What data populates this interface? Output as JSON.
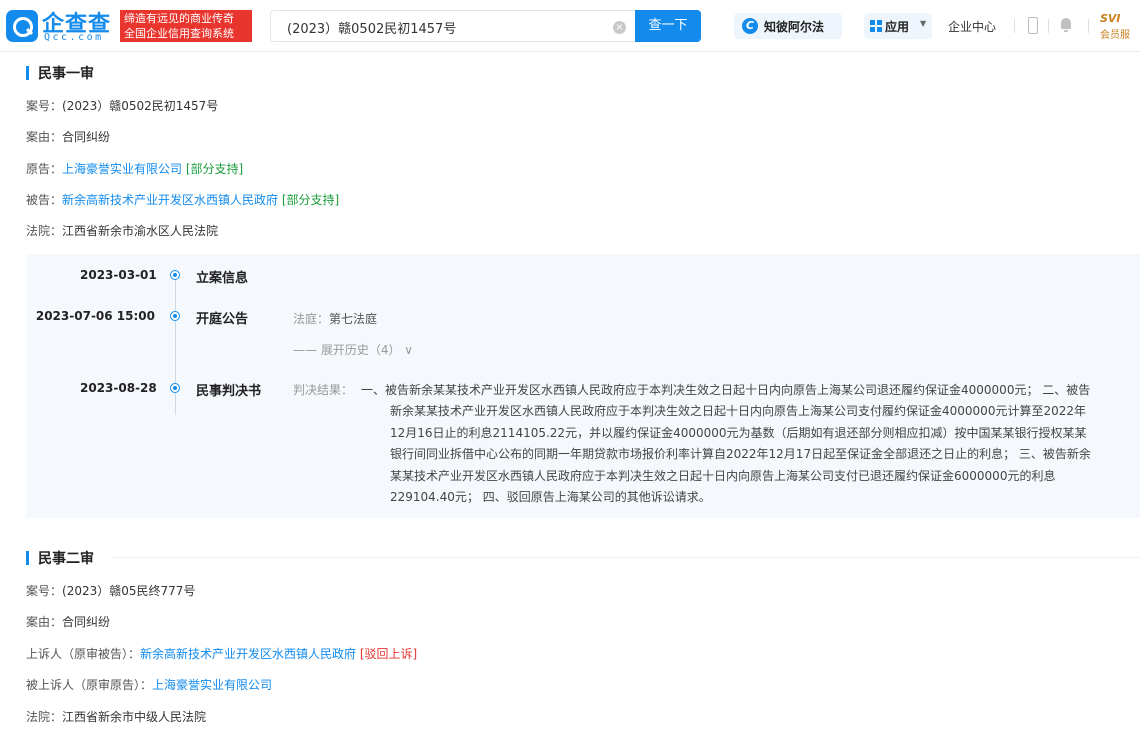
{
  "header": {
    "logo_text": "企查查",
    "logo_sub": "Qcc.com",
    "slogan_line1": "缔造有远见的商业传奇",
    "slogan_line2": "全国企业信用查询系统",
    "search_value": "(2023）赣0502民初1457号",
    "search_button": "查一下",
    "zhibi_label": "知彼阿尔法",
    "zhibi_icon_glyph": "C",
    "apps_label": "应用",
    "enterprise_label": "企业中心",
    "vip_top": "SVI",
    "vip_bottom": "会员服"
  },
  "first_instance": {
    "title": "民事一审",
    "case_no_k": "案号：",
    "case_no_v": "(2023）赣0502民初1457号",
    "cause_k": "案由：",
    "cause_v": "合同纠纷",
    "plaintiff_k": "原告：",
    "plaintiff_v": "上海豪誉实业有限公司",
    "plaintiff_tag": "[部分支持]",
    "defendant_k": "被告：",
    "defendant_v": "新余高新技术产业开发区水西镇人民政府",
    "defendant_tag": "[部分支持]",
    "court_k": "法院：",
    "court_v": "江西省新余市渝水区人民法院"
  },
  "timeline": [
    {
      "date": "2023-03-01",
      "label": "立案信息"
    },
    {
      "date": "2023-07-06 15:00",
      "label": "开庭公告",
      "detail_k": "法庭：",
      "detail_v": "第七法庭",
      "expand": "—— 展开历史（4） ∨"
    },
    {
      "date": "2023-08-28",
      "label": "民事判决书",
      "detail_k": "判决结果：",
      "detail_v": "一、被告新余某某技术产业开发区水西镇人民政府应于本判决生效之日起十日内向原告上海某公司退还履约保证金4000000元；  二、被告新余某某技术产业开发区水西镇人民政府应于本判决生效之日起十日内向原告上海某公司支付履约保证金4000000元计算至2022年12月16日止的利息2114105.22元，并以履约保证金4000000元为基数（后期如有退还部分则相应扣减）按中国某某银行授权某某银行间同业拆借中心公布的同期一年期贷款市场报价利率计算自2022年12月17日起至保证金全部退还之日止的利息；  三、被告新余某某技术产业开发区水西镇人民政府应于本判决生效之日起十日内向原告上海某公司支付已退还履约保证金6000000元的利息229104.40元；  四、驳回原告上海某公司的其他诉讼请求。"
    }
  ],
  "second_instance": {
    "title": "民事二审",
    "case_no_k": "案号：",
    "case_no_v": "(2023）赣05民终777号",
    "cause_k": "案由：",
    "cause_v": "合同纠纷",
    "appellant_k": "上诉人（原审被告）：",
    "appellant_v": "新余高新技术产业开发区水西镇人民政府",
    "appellant_tag": "[驳回上诉]",
    "appellee_k": "被上诉人（原审原告）：",
    "appellee_v": "上海豪誉实业有限公司",
    "court_k": "法院：",
    "court_v": "江西省新余市中级人民法院"
  },
  "colors": {
    "accent": "#128bed",
    "slogan_bg": "#e8352e",
    "tag_green": "#1a9d3b",
    "tag_red": "#e8352e",
    "timeline_bg": "#f5f8fc"
  }
}
